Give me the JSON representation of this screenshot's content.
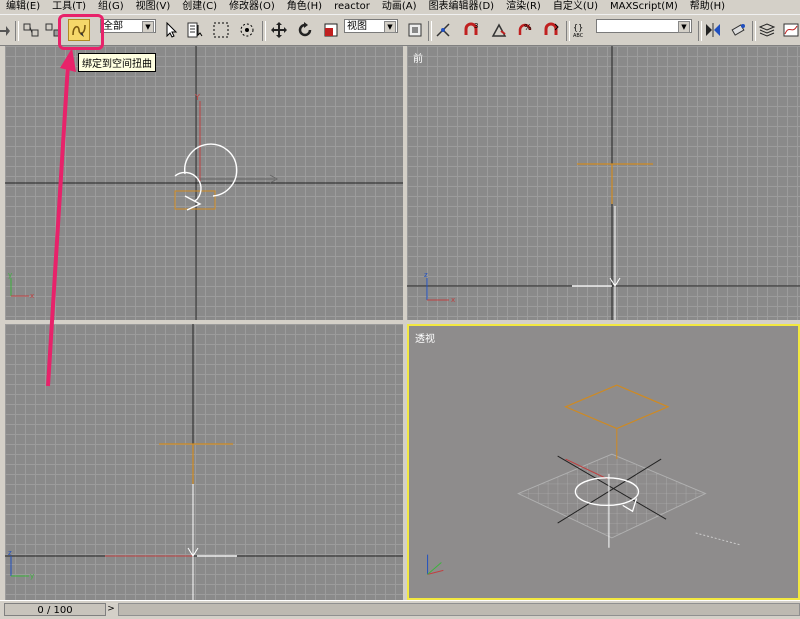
{
  "menu": [
    "编辑(E)",
    "工具(T)",
    "组(G)",
    "视图(V)",
    "创建(C)",
    "修改器(O)",
    "角色(H)",
    "reactor",
    "动画(A)",
    "图表编辑器(D)",
    "渲染(R)",
    "自定义(U)",
    "MAXScript(M)",
    "帮助(H)"
  ],
  "toolbar": {
    "selection_filter": "全部",
    "coordinate_system": "视图",
    "named_selection": "",
    "tooltip": "绑定到空间扭曲"
  },
  "viewports": {
    "top_left": "",
    "front": "前",
    "left": "",
    "perspective": "透视"
  },
  "status": {
    "time": "0 / 100"
  },
  "colors": {
    "highlight": "#e8226a",
    "active_viewport": "#f2e840",
    "object": "#d08a20"
  }
}
